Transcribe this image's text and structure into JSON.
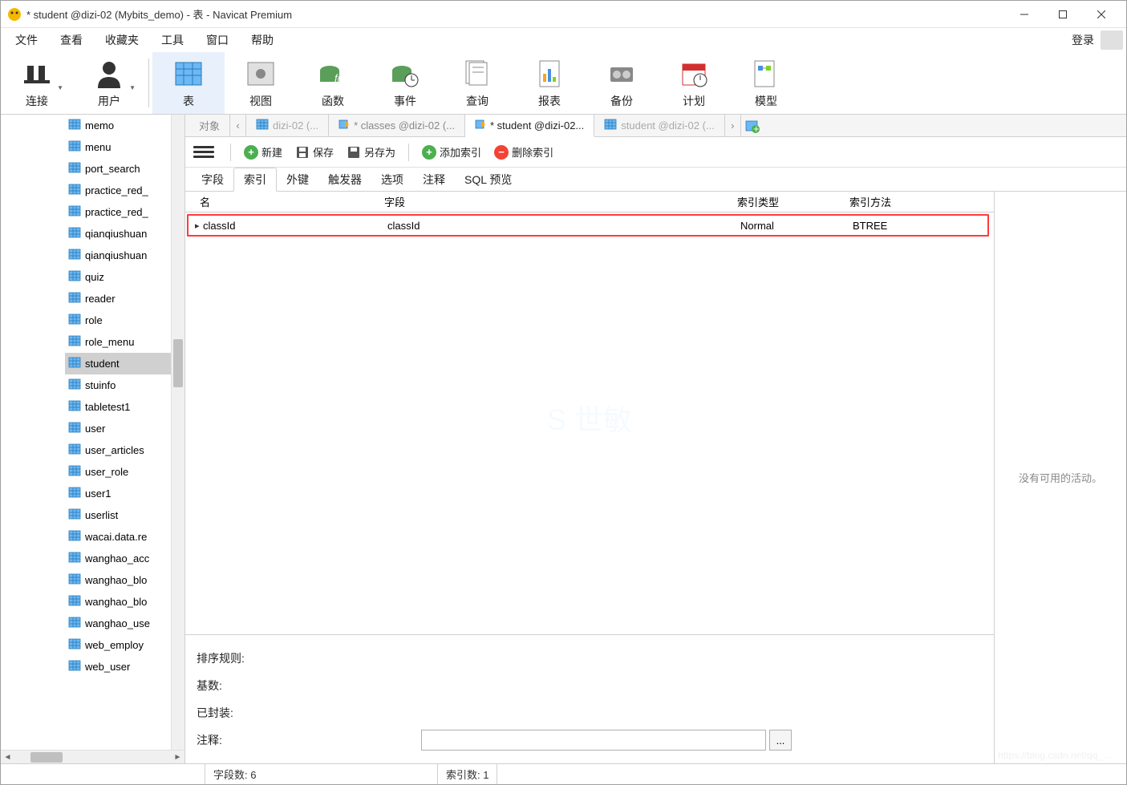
{
  "window": {
    "title": "* student @dizi-02 (Mybits_demo) - 表 - Navicat Premium"
  },
  "menubar": {
    "items": [
      "文件",
      "查看",
      "收藏夹",
      "工具",
      "窗口",
      "帮助"
    ],
    "login": "登录"
  },
  "toolbar": {
    "items": [
      {
        "label": "连接",
        "icon": "plug"
      },
      {
        "label": "用户",
        "icon": "user"
      },
      {
        "label": "表",
        "icon": "table",
        "active": true
      },
      {
        "label": "视图",
        "icon": "view"
      },
      {
        "label": "函数",
        "icon": "fx"
      },
      {
        "label": "事件",
        "icon": "event"
      },
      {
        "label": "查询",
        "icon": "query"
      },
      {
        "label": "报表",
        "icon": "report"
      },
      {
        "label": "备份",
        "icon": "backup"
      },
      {
        "label": "计划",
        "icon": "schedule"
      },
      {
        "label": "模型",
        "icon": "model"
      }
    ]
  },
  "sidebar": {
    "tables": [
      "memo",
      "menu",
      "port_search",
      "practice_red_",
      "practice_red_",
      "qianqiushuan",
      "qianqiushuan",
      "quiz",
      "reader",
      "role",
      "role_menu",
      "student",
      "stuinfo",
      "tabletest1",
      "user",
      "user_articles",
      "user_role",
      "user1",
      "userlist",
      "wacai.data.re",
      "wanghao_acc",
      "wanghao_blo",
      "wanghao_blo",
      "wanghao_use",
      "web_employ",
      "web_user"
    ],
    "selected": "student"
  },
  "tabs": {
    "items": [
      {
        "label": "对象",
        "icon": "none"
      },
      {
        "label": "dizi-02 (...",
        "icon": "table",
        "disabled": true
      },
      {
        "label": "* classes @dizi-02 (...",
        "icon": "edit"
      },
      {
        "label": "* student @dizi-02...",
        "icon": "edit",
        "active": true
      },
      {
        "label": "student @dizi-02 (...",
        "icon": "table",
        "disabled": true
      }
    ]
  },
  "actions": {
    "new": "新建",
    "save": "保存",
    "saveas": "另存为",
    "addindex": "添加索引",
    "delindex": "删除索引"
  },
  "subtabs": {
    "items": [
      "字段",
      "索引",
      "外键",
      "触发器",
      "选项",
      "注释",
      "SQL 预览"
    ],
    "active": "索引"
  },
  "grid": {
    "headers": {
      "name": "名",
      "field": "字段",
      "type": "索引类型",
      "method": "索引方法"
    },
    "rows": [
      {
        "name": "classId",
        "field": "classId",
        "type": "Normal",
        "method": "BTREE"
      }
    ]
  },
  "details": {
    "sort": "排序规则:",
    "base": "基数:",
    "packed": "已封装:",
    "comment": "注释:"
  },
  "right_panel": {
    "empty": "没有可用的活动。"
  },
  "statusbar": {
    "fields": "字段数: 6",
    "indexes": "索引数: 1"
  }
}
